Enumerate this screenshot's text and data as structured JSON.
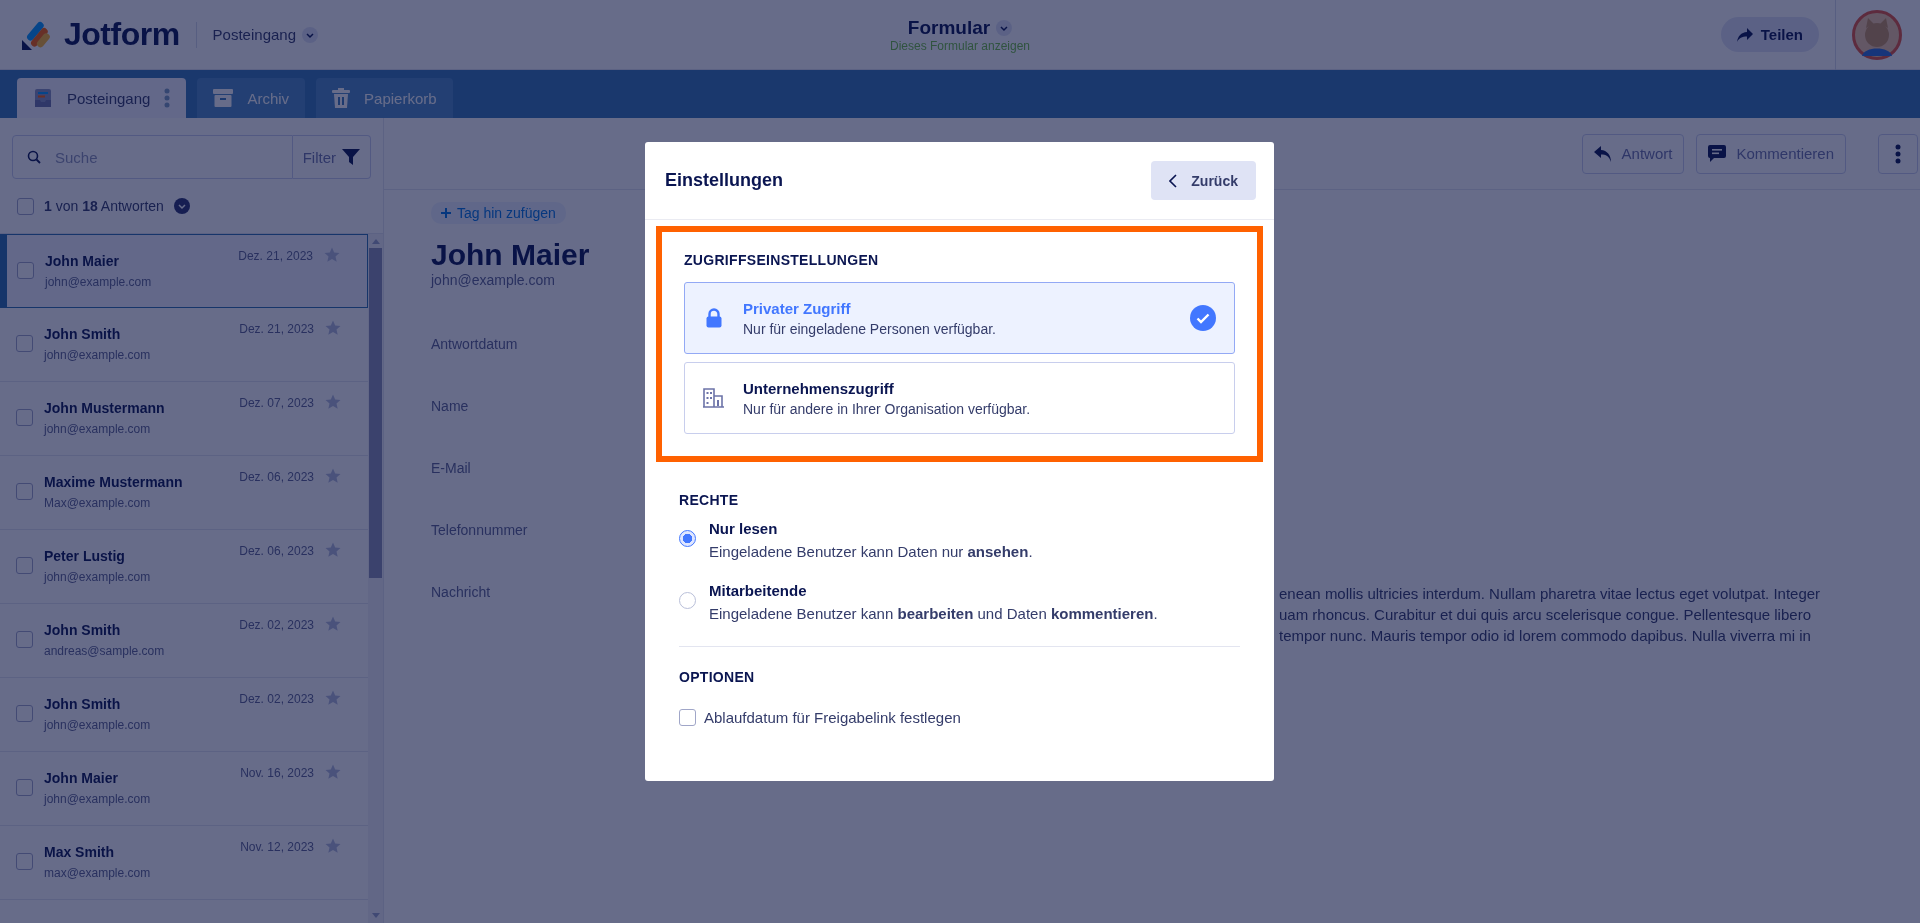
{
  "header": {
    "logo_text": "Jotform",
    "inbox_selector": "Posteingang",
    "form_title": "Formular",
    "form_subtitle": "Dieses Formular anzeigen",
    "share_button": "Teilen"
  },
  "tabs": [
    {
      "label": "Posteingang",
      "kind": "inbox",
      "selected": true
    },
    {
      "label": "Archiv",
      "kind": "archive",
      "selected": false
    },
    {
      "label": "Papierkorb",
      "kind": "trash",
      "selected": false
    }
  ],
  "sidebar": {
    "search": {
      "placeholder": "Suche"
    },
    "filter_button": "Filter",
    "select_all": {
      "checked": false
    },
    "count": "**1** von **18** Antworten",
    "submissions": [
      {
        "name": "John Maier",
        "email": "john@example.com",
        "date": "Dez. 21, 2023",
        "selected": true,
        "checked": false,
        "starred": false
      },
      {
        "name": "John Smith",
        "email": "john@example.com",
        "date": "Dez. 21, 2023",
        "selected": false,
        "checked": false,
        "starred": false
      },
      {
        "name": "John Mustermann",
        "email": "john@example.com",
        "date": "Dez. 07, 2023",
        "selected": false,
        "checked": false,
        "starred": false
      },
      {
        "name": "Maxime Mustermann",
        "email": "Max@example.com",
        "date": "Dez. 06, 2023",
        "selected": false,
        "checked": false,
        "starred": false
      },
      {
        "name": "Peter Lustig",
        "email": "john@example.com",
        "date": "Dez. 06, 2023",
        "selected": false,
        "checked": false,
        "starred": false
      },
      {
        "name": "John Smith",
        "email": "andreas@sample.com",
        "date": "Dez. 02, 2023",
        "selected": false,
        "checked": false,
        "starred": false
      },
      {
        "name": "John Smith",
        "email": "john@example.com",
        "date": "Dez. 02, 2023",
        "selected": false,
        "checked": false,
        "starred": false
      },
      {
        "name": "John Maier",
        "email": "john@example.com",
        "date": "Nov. 16, 2023",
        "selected": false,
        "checked": false,
        "starred": false
      },
      {
        "name": "Max Smith",
        "email": "max@example.com",
        "date": "Nov. 12, 2023",
        "selected": false,
        "checked": false,
        "starred": false
      }
    ]
  },
  "toolbar": {
    "reply_button": "Antwort",
    "comment_button": "Kommentieren"
  },
  "detail": {
    "tag_button": "Tag hin zufügen",
    "name": "John Maier",
    "email": "john@example.com",
    "fields": [
      {
        "label": "Antwortdatum"
      },
      {
        "label": "Name"
      },
      {
        "label": "E-Mail"
      },
      {
        "label": "Telefonnummer"
      },
      {
        "label": "Nachricht",
        "lines": [
          "enean mollis ultricies interdum. Nullam pharetra vitae lectus eget volutpat. Integer",
          "uam rhoncus. Curabitur et dui quis arcu scelerisque congue. Pellentesque libero",
          "tempor nunc. Mauris tempor odio id lorem commodo dapibus. Nulla viverra mi in"
        ]
      }
    ]
  },
  "modal": {
    "title": "Einstellungen",
    "back_button": "Zurück",
    "access": {
      "heading": "ZUGRIFFSEINSTELLUNGEN",
      "options": [
        {
          "kind": "lock",
          "title": "Privater Zugriff",
          "description": "Nur für eingeladene Personen verfügbar.",
          "selected": true
        },
        {
          "kind": "building",
          "title": "Unternehmenszugriff",
          "description": "Nur für andere in Ihrer Organisation verfügbar.",
          "selected": false
        }
      ]
    },
    "rights": {
      "heading": "RECHTE",
      "options": [
        {
          "title": "Nur lesen",
          "description": "Eingeladene Benutzer kann Daten nur **ansehen**.",
          "selected": true
        },
        {
          "title": "Mitarbeitende",
          "description": "Eingeladene Benutzer kann **bearbeiten** und Daten **kommentieren**.",
          "selected": false
        }
      ]
    },
    "options": {
      "heading": "OPTIONEN",
      "items": [
        {
          "label": "Ablaufdatum für Freigabelink festlegen",
          "checked": false
        }
      ]
    }
  }
}
